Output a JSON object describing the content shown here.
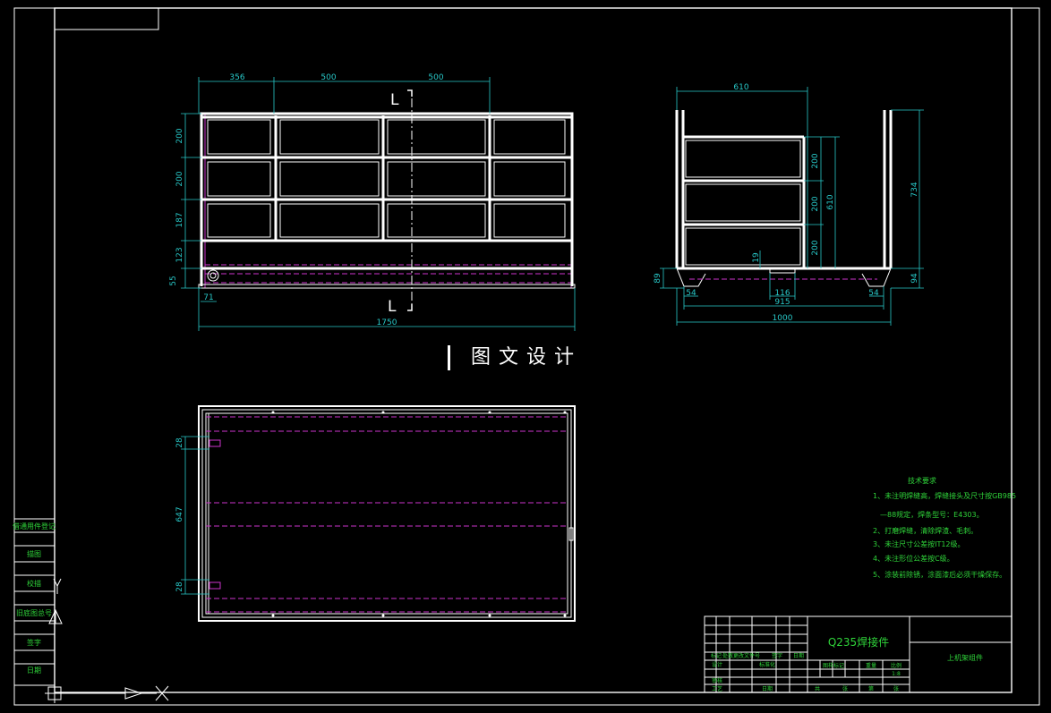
{
  "watermark": "图文设计",
  "front_view": {
    "dims_top": [
      "356",
      "500",
      "500"
    ],
    "dims_left": [
      "200",
      "200",
      "187",
      "123",
      "55"
    ],
    "dim_small": "71",
    "dim_total": "1750",
    "section_marker": "L"
  },
  "side_view": {
    "dim_top": "610",
    "dims_right_inner": [
      "200",
      "200",
      "200"
    ],
    "dim_610": "610",
    "dim_734": "734",
    "dim_94": "94",
    "dim_89": "89",
    "dim_19": "19",
    "dims_bottom": [
      "54",
      "116",
      "54"
    ],
    "dim_915": "915",
    "dim_1000": "1000"
  },
  "top_view": {
    "dims_left": [
      "28",
      "647",
      "28"
    ]
  },
  "tech_notes": {
    "title": "技术要求",
    "items": [
      "1、未注明焊缝高，焊缝接头及尺寸按GB985",
      "—88规定，焊条型号：E4303。",
      "2、打磨焊缝，清除焊渣、毛刺。",
      "3、未注尺寸公差按IT12级。",
      "4、未注形位公差按C级。",
      "5、涂装前除锈，涂面漆后必须干燥保存。"
    ]
  },
  "title_block": {
    "material": "Q235焊接件",
    "drawing_name": "上机架组件",
    "ratio": "1:8",
    "headers": [
      "标记",
      "处数",
      "更改文件号",
      "签字",
      "日期"
    ],
    "row_labels": [
      "设计",
      "标准化",
      "审核",
      "工艺",
      "日期"
    ],
    "stage_cells": [
      "图样标记",
      "重量",
      "比例"
    ],
    "sheet_cells": [
      "共",
      "张",
      "第",
      "张"
    ]
  },
  "side_panel": {
    "labels": [
      "借通用件登记",
      "描图",
      "校描",
      "旧底图总号",
      "签字",
      "日期"
    ]
  }
}
